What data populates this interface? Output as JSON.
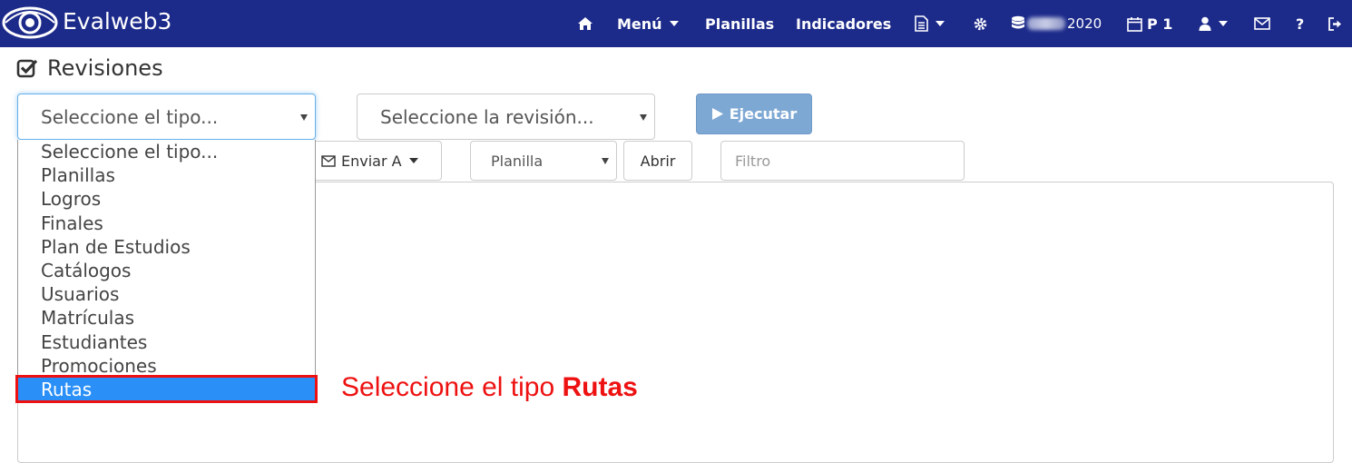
{
  "app": {
    "title": "Evalweb3"
  },
  "nav": {
    "menu_label": "Menú",
    "planillas_label": "Planillas",
    "indicadores_label": "Indicadores",
    "year_label": "2020",
    "period_label": "P 1",
    "help_label": "?"
  },
  "page": {
    "title": "Revisiones"
  },
  "controls": {
    "type_select_value": "Seleccione el tipo...",
    "revision_select_value": "Seleccione la revisión...",
    "execute_label": "Ejecutar",
    "send_label": "Enviar A",
    "planilla_select_value": "Planilla",
    "open_label": "Abrir",
    "filter_placeholder": "Filtro"
  },
  "type_options": [
    "Seleccione el tipo...",
    "Planillas",
    "Logros",
    "Finales",
    "Plan de Estudios",
    "Catálogos",
    "Usuarios",
    "Matrículas",
    "Estudiantes",
    "Promociones",
    "Rutas"
  ],
  "selected_option": "Rutas",
  "annotation": {
    "text": "Seleccione el tipo",
    "emphasis": "Rutas"
  },
  "colors": {
    "navbar": "#1c2a8a",
    "accent_selected": "#2a8ff7",
    "execute_button": "#7ea8d4",
    "annotation": "#e11111"
  }
}
